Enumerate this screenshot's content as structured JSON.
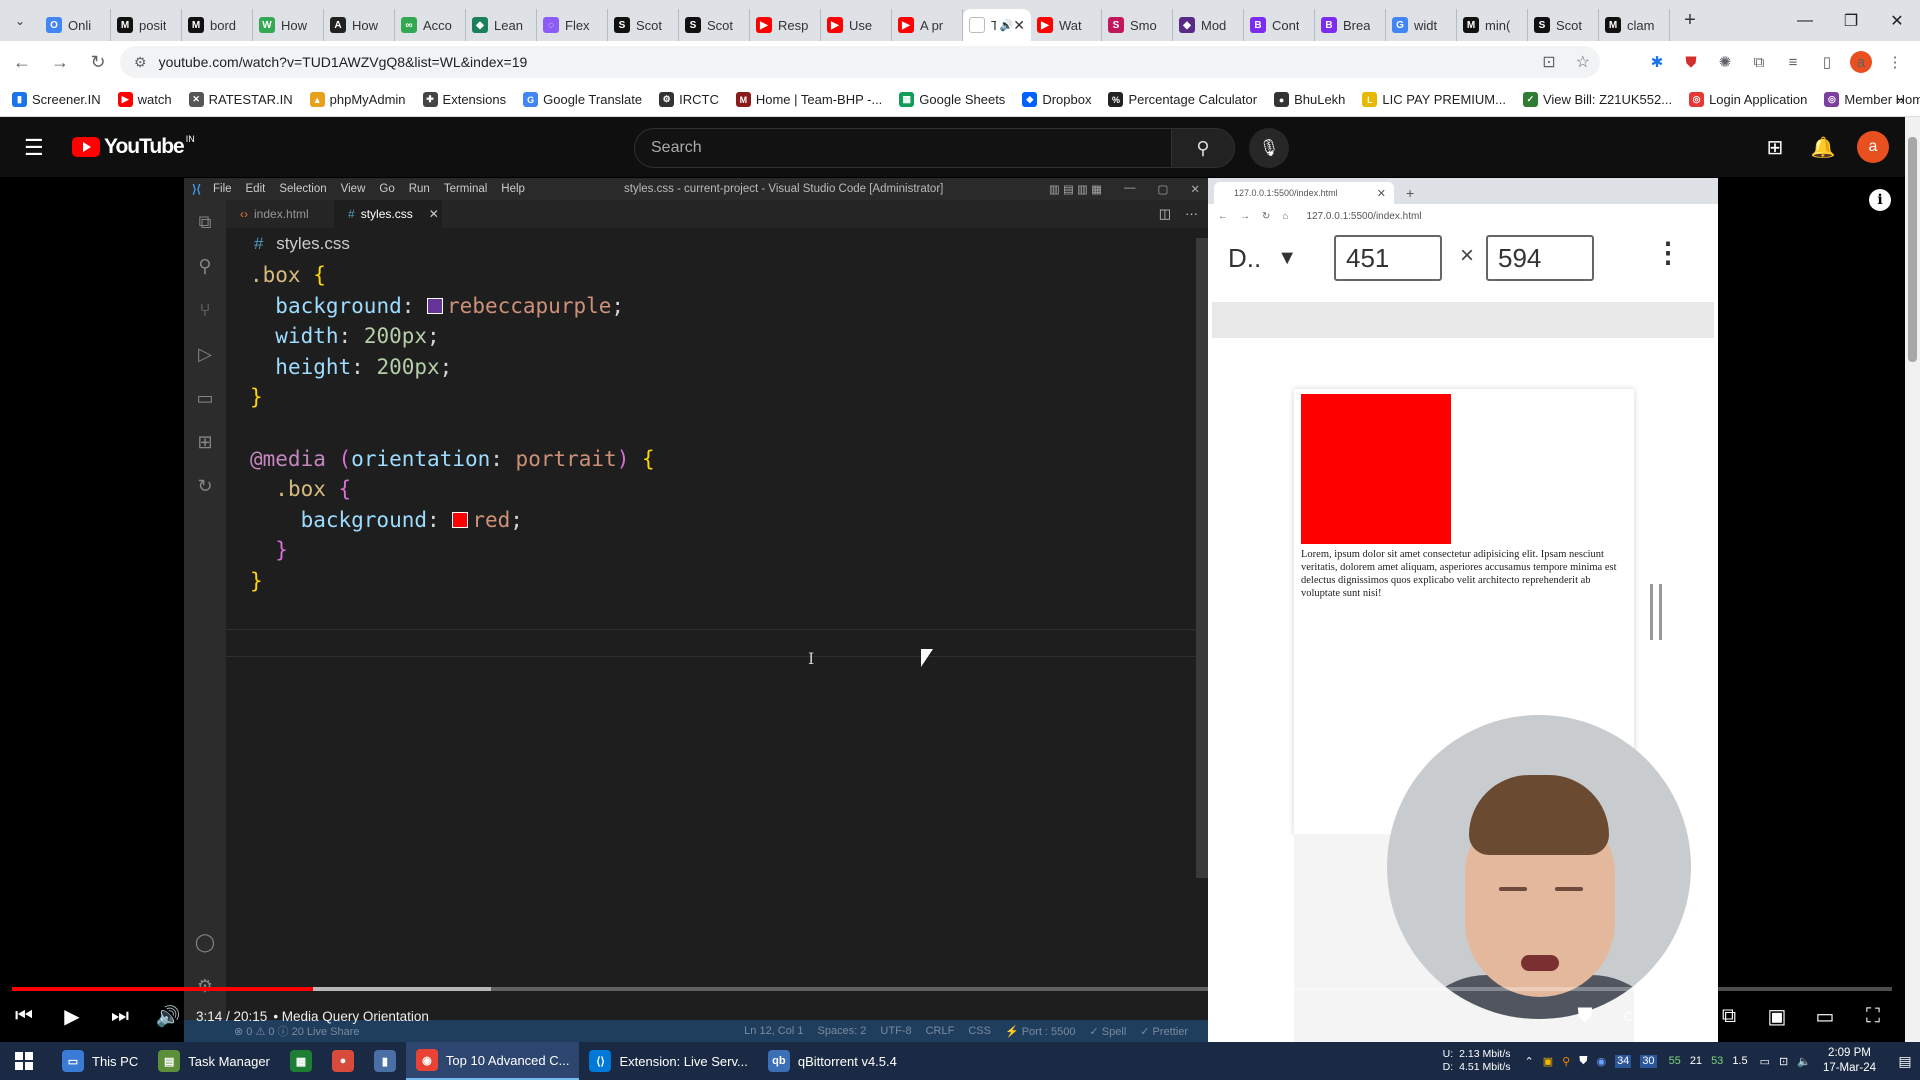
{
  "browser": {
    "tabs": [
      {
        "label": "Onli",
        "icon": "O",
        "color": "#4285f4"
      },
      {
        "label": "posit",
        "icon": "M",
        "color": "#111111"
      },
      {
        "label": "bord",
        "icon": "M",
        "color": "#111111"
      },
      {
        "label": "How",
        "icon": "W",
        "color": "#34a853"
      },
      {
        "label": "How",
        "icon": "A",
        "color": "#222222"
      },
      {
        "label": "Acco",
        "icon": "∞",
        "color": "#33a852"
      },
      {
        "label": "Lean",
        "icon": "◆",
        "color": "#1a7f5a"
      },
      {
        "label": "Flex",
        "icon": "◌",
        "color": "#8b5cf6"
      },
      {
        "label": "Scot",
        "icon": "S",
        "color": "#111111"
      },
      {
        "label": "Scot",
        "icon": "S",
        "color": "#111111"
      },
      {
        "label": "Resp",
        "icon": "▶",
        "color": "#ff0000"
      },
      {
        "label": "Use",
        "icon": "▶",
        "color": "#ff0000"
      },
      {
        "label": "A pr",
        "icon": "▶",
        "color": "#ff0000"
      },
      {
        "label": "Tc",
        "icon": "",
        "color": "#ffffff",
        "active": true
      },
      {
        "label": "Wat",
        "icon": "▶",
        "color": "#ff0000"
      },
      {
        "label": "Smo",
        "icon": "S",
        "color": "#c2185b"
      },
      {
        "label": "Mod",
        "icon": "◆",
        "color": "#5b2a86"
      },
      {
        "label": "Cont",
        "icon": "B",
        "color": "#7b2cf0"
      },
      {
        "label": "Brea",
        "icon": "B",
        "color": "#7b2cf0"
      },
      {
        "label": "widt",
        "icon": "G",
        "color": "#4285f4"
      },
      {
        "label": "min(",
        "icon": "M",
        "color": "#111111"
      },
      {
        "label": "Scot",
        "icon": "S",
        "color": "#111111"
      },
      {
        "label": "clam",
        "icon": "M",
        "color": "#111111"
      }
    ],
    "url": "youtube.com/watch?v=TUD1AWZVgQ8&list=WL&index=19",
    "bookmarks": [
      {
        "label": "Screener.IN",
        "color": "#1a73e8",
        "icon": "▮"
      },
      {
        "label": "watch",
        "color": "#ff0000",
        "icon": "▶"
      },
      {
        "label": "RATESTAR.IN",
        "color": "#555555",
        "icon": "✕"
      },
      {
        "label": "phpMyAdmin",
        "color": "#e8a21a",
        "icon": "▲"
      },
      {
        "label": "Extensions",
        "color": "#444444",
        "icon": "✚"
      },
      {
        "label": "Google Translate",
        "color": "#4285f4",
        "icon": "G"
      },
      {
        "label": "IRCTC",
        "color": "#333333",
        "icon": "⚙"
      },
      {
        "label": "Home | Team-BHP -...",
        "color": "#8b1a1a",
        "icon": "M"
      },
      {
        "label": "Google Sheets",
        "color": "#0f9d58",
        "icon": "▦"
      },
      {
        "label": "Dropbox",
        "color": "#0061ff",
        "icon": "◆"
      },
      {
        "label": "Percentage Calculator",
        "color": "#222222",
        "icon": "%"
      },
      {
        "label": "BhuLekh",
        "color": "#333333",
        "icon": "●"
      },
      {
        "label": "LIC PAY PREMIUM...",
        "color": "#e8b800",
        "icon": "L"
      },
      {
        "label": "View Bill: Z21UK552...",
        "color": "#2e7d32",
        "icon": "✓"
      },
      {
        "label": "Login Application",
        "color": "#e53935",
        "icon": "◎"
      },
      {
        "label": "Member Home",
        "color": "#7b3fa0",
        "icon": "◎"
      }
    ],
    "more_bookmarks": "»"
  },
  "youtube": {
    "logo": "YouTube",
    "country": "IN",
    "search_placeholder": "Search",
    "avatar_letter": "a"
  },
  "vscode": {
    "menu": [
      "File",
      "Edit",
      "Selection",
      "View",
      "Go",
      "Run",
      "Terminal",
      "Help"
    ],
    "title": "styles.css - current-project - Visual Studio Code [Administrator]",
    "tabs": [
      {
        "label": "index.html",
        "active": false
      },
      {
        "label": "styles.css",
        "active": true
      }
    ],
    "breadcrumb": "styles.css",
    "code": {
      "sel1": ".box",
      "p1": "background",
      "v1": "rebeccapurple",
      "swatch1": "#663399",
      "p2": "width",
      "v2": "200px",
      "p3": "height",
      "v3": "200px",
      "at": "@media",
      "feature": "orientation",
      "feature_val": "portrait",
      "sel2": ".box",
      "p4": "background",
      "v4": "red",
      "swatch2": "#ff0000"
    },
    "status_left": "⊗ 0 ⚠ 0 ⓘ 20   Live Share",
    "status_right": [
      "Ln 12, Col 1",
      "Spaces: 2",
      "UTF-8",
      "CRLF",
      "CSS",
      "⚡ Port : 5500",
      "✓ Spell",
      "✓ Prettier"
    ]
  },
  "preview": {
    "tab_title": "127.0.0.1:5500/index.html",
    "url": "127.0.0.1:5500/index.html",
    "device": "D..",
    "width": "451",
    "height": "594",
    "times": "×",
    "box_color": "#ff0000",
    "lorem": "Lorem, ipsum dolor sit amet consectetur adipisicing elit. Ipsam nesciunt veritatis, dolorem amet aliquam, asperiores accusamus tempore minima est delectus dignissimos quos explicabo velit architecto reprehenderit ab voluptate sunt nisi!"
  },
  "player": {
    "time": "3:14 / 20:15",
    "chapter": "• Media Query Orientation",
    "progress_fraction": 0.16,
    "buffered_fraction": 0.255
  },
  "taskbar": {
    "items": [
      {
        "label": "This PC",
        "icon": "▭",
        "color": "#3a7bd5",
        "active": false
      },
      {
        "label": "Task Manager",
        "icon": "▤",
        "color": "#5d8f3b",
        "active": false
      },
      {
        "label": "",
        "icon": "▦",
        "color": "#1e7e34",
        "active": false
      },
      {
        "label": "",
        "icon": "●",
        "color": "#d84a3a",
        "active": false
      },
      {
        "label": "",
        "icon": "▮",
        "color": "#4a6fa5",
        "active": false
      },
      {
        "label": "Top 10 Advanced C...",
        "icon": "◉",
        "color": "#ea4335",
        "active": true
      },
      {
        "label": "Extension: Live Serv...",
        "icon": "⟨⟩",
        "color": "#0078d7",
        "active": false
      },
      {
        "label": "qBittorrent v4.5.4",
        "icon": "qb",
        "color": "#3b6fb6",
        "active": false
      }
    ],
    "upload_label": "U:",
    "download_label": "D:",
    "upload": "2.13 Mbit/s",
    "download": "4.51 Mbit/s",
    "tray_numbers": [
      "55",
      "21",
      "53",
      "1.5"
    ],
    "time": "2:09 PM",
    "date": "17-Mar-24"
  }
}
